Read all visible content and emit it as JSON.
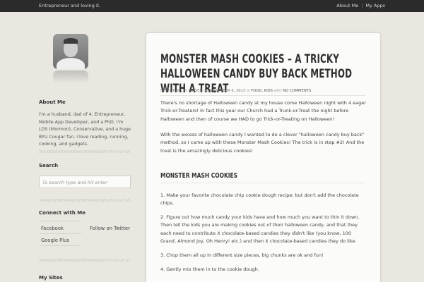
{
  "topbar": {
    "tagline": "Entrepreneur and loving it.",
    "nav": [
      "About Me",
      "My Apps"
    ]
  },
  "sidebar": {
    "about": {
      "title": "About Me",
      "text": "I'm a husband, dad of 4, Entrepreneur, Mobile App Developer, and a PhD. I'm LDS (Mormon), Conservative, and a huge BYU Cougar fan. I love reading, running, cooking, and gadgets."
    },
    "search": {
      "title": "Search",
      "placeholder": "To search type and hit enter"
    },
    "connect": {
      "title": "Connect with Me",
      "links": [
        "Facebook",
        "Follow on Twitter",
        "Google Plus"
      ]
    },
    "sites": {
      "title": "My Sites"
    }
  },
  "post": {
    "title": "MONSTER MASH COOKIES – A TRICKY HALLOWEEN CANDY BUY BACK METHOD WITH A TREAT",
    "meta": {
      "by": "by",
      "author": "MICHAEL D. JENSEN",
      "on": "on",
      "date": "NOVEMBER 6, 2013",
      "in": "in",
      "categories": "FOOD, KIDS",
      "with": "with",
      "comments": "NO COMMENTS"
    },
    "paragraphs": [
      "There's no shortage of Halloween candy at my house come Halloween night with 4 eager Trick-or-Treaters! In fact this year our Church had a Trunk-or-Treat the night before Halloween and then of course we HAD to go Trick-or-Treating on Halloween!",
      "With the excess of halloween candy I wanted to do a clever \"halloween candy buy back\" method, so I came up with these Monster Mash Cookies! The trick is in step #2! And the treat is the amazingly delicious cookies!"
    ],
    "section_heading": "MONSTER MASH COOKIES",
    "steps": [
      "1. Make your favorite chocolate chip cookie dough recipe; but don't add the chocolate chips.",
      "2. Figure out how much candy your kids have and how much you want to thin it down. Then tell the kids you are making cookies out of their halloween candy, and that they each need to contribute X chocolate-based candies they didn't like (you know, 100 Grand, Almond Joy, Oh Henry! etc.) and then X chocolate-based candies they do like.",
      "3. Chop them all up in different size pieces, big chunks are ok and fun!",
      "4. Gently mix them in to the cookie dough."
    ]
  }
}
